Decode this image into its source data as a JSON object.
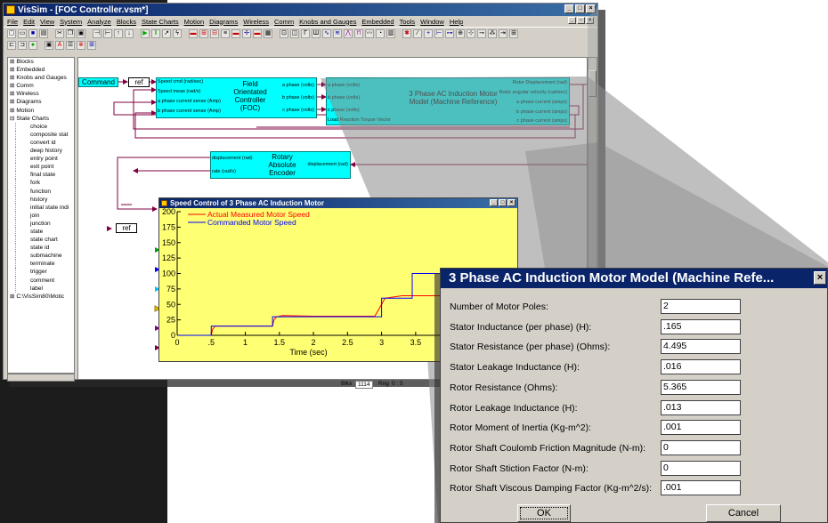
{
  "window": {
    "title": "VisSim - [FOC Controller.vsm*]",
    "menu": [
      "File",
      "Edit",
      "View",
      "System",
      "Analyze",
      "Blocks",
      "State Charts",
      "Motion",
      "Diagrams",
      "Wireless",
      "Comm",
      "Knobs and Gauges",
      "Embedded",
      "Tools",
      "Window",
      "Help"
    ]
  },
  "tree": {
    "items": [
      {
        "label": "Blocks",
        "level": 0
      },
      {
        "label": "Embedded",
        "level": 0
      },
      {
        "label": "Knobs and Gauges",
        "level": 0
      },
      {
        "label": "Comm",
        "level": 0
      },
      {
        "label": "Wireless",
        "level": 0
      },
      {
        "label": "Diagrams",
        "level": 0
      },
      {
        "label": "Motion",
        "level": 0
      },
      {
        "label": "State Charts",
        "level": 0
      },
      {
        "label": "choice",
        "level": 1
      },
      {
        "label": "composite stat",
        "level": 1
      },
      {
        "label": "convert id",
        "level": 1
      },
      {
        "label": "deep history",
        "level": 1
      },
      {
        "label": "entry point",
        "level": 1
      },
      {
        "label": "exit point",
        "level": 1
      },
      {
        "label": "final state",
        "level": 1
      },
      {
        "label": "fork",
        "level": 1
      },
      {
        "label": "function",
        "level": 1
      },
      {
        "label": "history",
        "level": 1
      },
      {
        "label": "initial state indi",
        "level": 1
      },
      {
        "label": "join",
        "level": 1
      },
      {
        "label": "junction",
        "level": 1
      },
      {
        "label": "state",
        "level": 1
      },
      {
        "label": "state chart",
        "level": 1
      },
      {
        "label": "state id",
        "level": 1
      },
      {
        "label": "submachine",
        "level": 1
      },
      {
        "label": "terminate",
        "level": 1
      },
      {
        "label": "trigger",
        "level": 1
      },
      {
        "label": "comment",
        "level": 1
      },
      {
        "label": "label",
        "level": 1
      },
      {
        "label": "C:\\VisSim80\\Motic",
        "level": 0
      }
    ]
  },
  "diagram": {
    "command_label": "Command",
    "ref_label": "ref",
    "foc": {
      "title": "Field Orientated Controller (FOC)",
      "inputs": [
        "Speed cmd (rad/sec)",
        "Speed meas (rad/s)",
        "a phase current sense (Amp)",
        "b phase current sense (Amp)"
      ],
      "outputs": [
        "a phase (volts)",
        "b phase (volts)",
        "c phase (volts)"
      ]
    },
    "motor": {
      "title": "3 Phase AC Induction Motor Model (Machine Reference)",
      "inputs": [
        "a phase (volts)",
        "b phase (volts)",
        "c phase (volts)",
        "Load Reaction Torque Vector"
      ],
      "outputs": [
        "Rotor Displacement (rad)",
        "Rotor angular velocity (rad/sec)",
        "a phase current (amps)",
        "b phase current (amps)",
        "c phase current (amps)"
      ]
    },
    "encoder": {
      "title": "Rotary Absolute Encoder",
      "inputs": [
        "displacement (rad)"
      ],
      "outputs_left": [
        "displacement (rad)",
        "rate (rad/s)"
      ]
    }
  },
  "status": {
    "blks_label": "Blks",
    "blks_value": "1114",
    "rng_label": "Rng",
    "rng_value": "0 : 5"
  },
  "plot": {
    "title": "Speed Control of 3 Phase AC Induction Motor",
    "xlabel": "Time (sec)"
  },
  "chart_data": {
    "type": "line",
    "title": "Speed Control of 3 Phase AC Induction Motor",
    "xlabel": "Time (sec)",
    "ylabel": "",
    "xlim": [
      0,
      4.9
    ],
    "ylim": [
      0,
      200
    ],
    "x_ticks": [
      "0",
      ".5",
      "1",
      "1.5",
      "2",
      "2.5",
      "3",
      "3.5"
    ],
    "y_ticks": [
      "0",
      "25",
      "50",
      "75",
      "100",
      "125",
      "150",
      "175",
      "200"
    ],
    "series": [
      {
        "name": "Actual Measured Motor Speed",
        "color": "#ff0000",
        "x": [
          0,
          0.5,
          0.52,
          0.56,
          1.0,
          1.4,
          1.42,
          1.46,
          1.55,
          2.0,
          2.5,
          2.9,
          3.0,
          3.05,
          3.3,
          3.6,
          4.0,
          4.5,
          4.9
        ],
        "y": [
          0,
          0,
          10,
          15,
          15,
          15,
          25,
          30,
          32,
          31,
          31,
          31,
          50,
          60,
          64,
          64,
          64,
          64,
          64
        ]
      },
      {
        "name": "Commanded Motor Speed",
        "color": "#0000ff",
        "x": [
          0,
          0.5,
          0.5,
          1.4,
          1.4,
          3.0,
          3.0,
          3.45,
          3.45,
          4.9
        ],
        "y": [
          0,
          0,
          15,
          15,
          30,
          30,
          60,
          60,
          100,
          100
        ]
      }
    ],
    "grid": false,
    "legend": "top-left"
  },
  "dialog": {
    "title": "3 Phase AC Induction Motor Model (Machine Refe...",
    "params": [
      {
        "label": "Number of Motor Poles:",
        "value": "2"
      },
      {
        "label": "Stator Inductance (per phase) (H):",
        "value": ".165"
      },
      {
        "label": "Stator Resistance (per phase) (Ohms):",
        "value": "4.495"
      },
      {
        "label": "Stator Leakage Inductance (H):",
        "value": ".016"
      },
      {
        "label": "Rotor Resistance (Ohms):",
        "value": "5.365"
      },
      {
        "label": "Rotor Leakage Inductance (H):",
        "value": ".013"
      },
      {
        "label": "Rotor Moment of Inertia (Kg-m^2):",
        "value": ".001"
      },
      {
        "label": "Rotor Shaft Coulomb Friction Magnitude (N-m):",
        "value": "0"
      },
      {
        "label": "Rotor Shaft Stiction Factor (N-m):",
        "value": "0"
      },
      {
        "label": "Rotor Shaft Viscous Damping Factor (Kg-m^2/s):",
        "value": ".001"
      }
    ],
    "ok_label": "OK",
    "cancel_label": "Cancel"
  },
  "colors": {
    "block_fill": "#00ffff",
    "plot_bg": "#ffff73",
    "wire": "#800040",
    "title_bar": "#0a246a"
  }
}
